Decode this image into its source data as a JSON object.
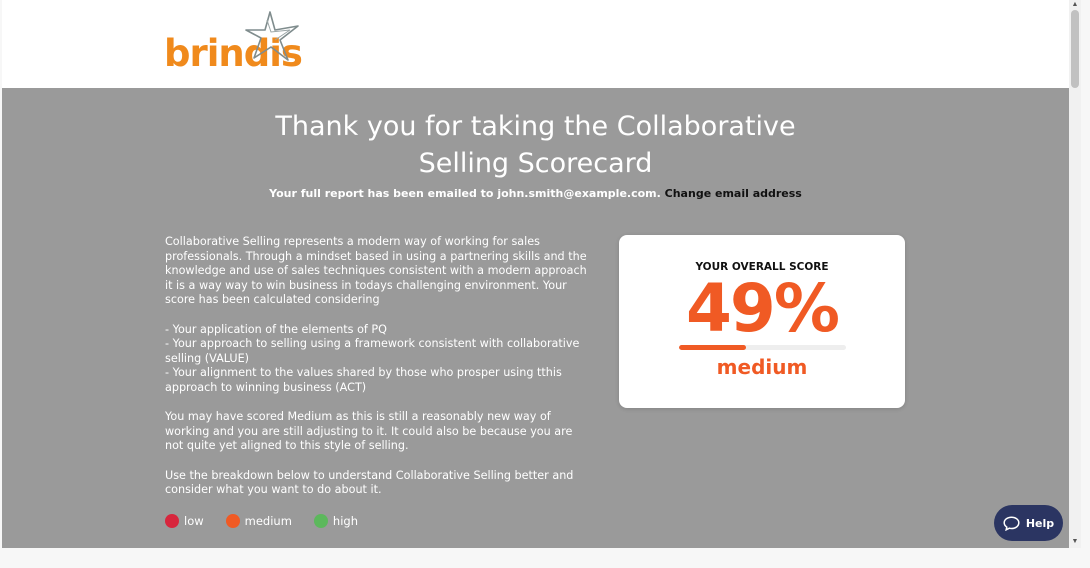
{
  "logo": {
    "text": "brindis",
    "star": "star-outline-icon"
  },
  "hero": {
    "title_line1": "Thank you for taking the Collaborative",
    "title_line2": "Selling Scorecard",
    "email_notice": "Your full report has been emailed to john.smith@example.com.",
    "change_email": "Change email address"
  },
  "body": {
    "p1": "Collaborative Selling represents a modern way of working for sales professionals. Through a mindset based in using a partnering skills and the knowledge and use of sales techniques consistent with a modern approach it is a way way to win business in todays challenging environment. Your score has been calculated considering",
    "b1": "- Your application of the elements of PQ",
    "b2": "- Your approach to selling using a framework consistent with collaborative selling (VALUE)",
    "b3": "- Your alignment to the values shared by those who prosper using tthis approach to winning business (ACT)",
    "p2": "You may have scored Medium as this is still a reasonably new way of working and you are still adjusting to it. It could also be because you are not quite yet aligned to this style of selling.",
    "p3": "Use the breakdown below to understand Collaborative Selling better and consider what you want to do about it."
  },
  "score": {
    "label": "YOUR OVERALL SCORE",
    "value": "49%",
    "fraction": 0.4,
    "level": "medium"
  },
  "legend": [
    {
      "label": "low",
      "color": "#d7263d"
    },
    {
      "label": "medium",
      "color": "#f05a24"
    },
    {
      "label": "high",
      "color": "#5cb85c"
    }
  ],
  "help": {
    "label": "Help",
    "icon": "chat-bubble-icon"
  },
  "colors": {
    "accent": "#f05a24",
    "logo": "#f08a1c",
    "hero_bg": "#9a9a9a",
    "help_bg": "#2b3562"
  }
}
